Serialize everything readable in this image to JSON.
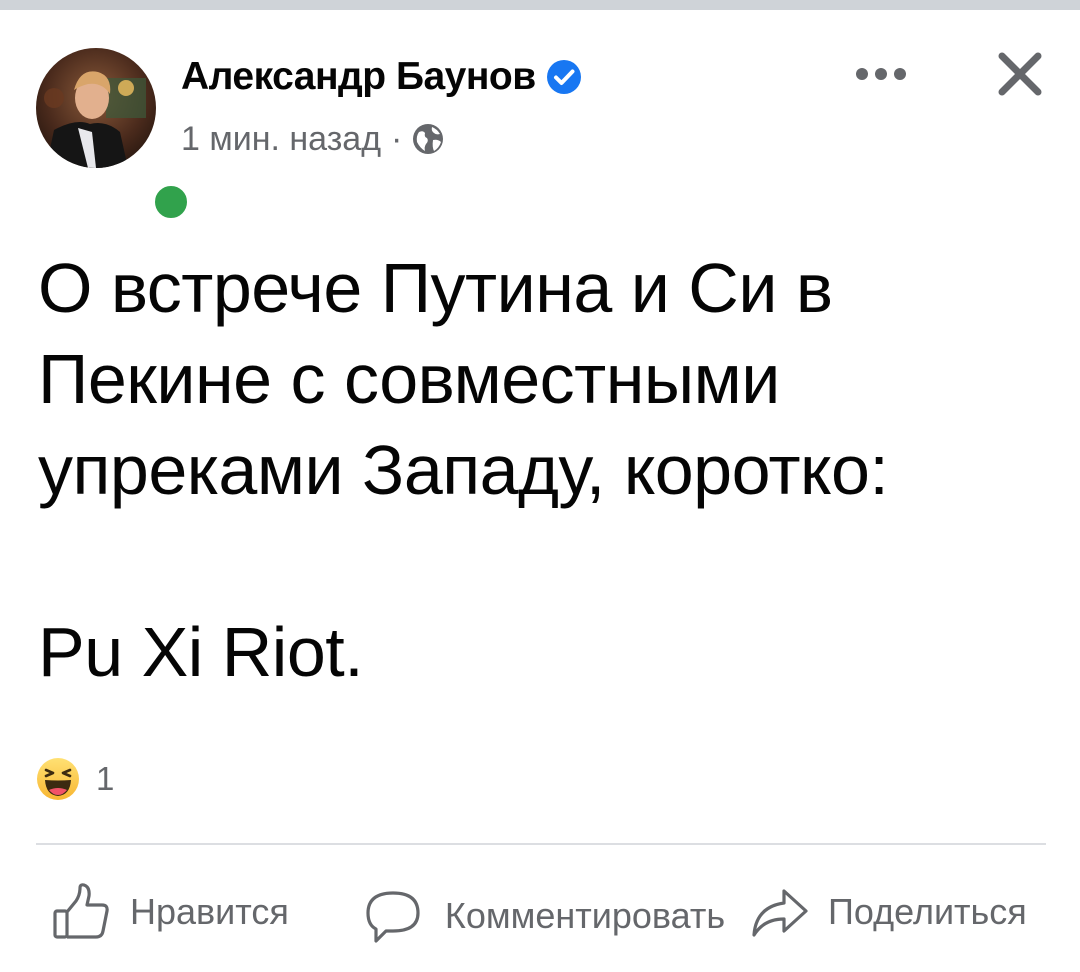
{
  "post": {
    "author": "Александр Баунов",
    "time": "1 мин. назад",
    "separator": "·",
    "paragraphs": [
      "О встрече Путина и Си в",
      "Пекине с совместными",
      "упреками Западу, коротко:",
      "Pu Xi Riot."
    ]
  },
  "reactions": {
    "type": "haha",
    "count": "1"
  },
  "actions": {
    "like_label": "Нравится",
    "comment_label": "Комментировать",
    "share_label": "Поделиться"
  },
  "icons": {
    "verified": "verified-badge-icon",
    "audience": "globe-icon",
    "more": "more-options-icon",
    "close": "close-icon",
    "like": "thumbs-up-icon",
    "comment": "comment-bubble-icon",
    "share": "share-arrow-icon"
  },
  "colors": {
    "verified_blue": "#1877f2",
    "online_green": "#31a24c",
    "secondary_text": "#65676b",
    "primary_text": "#050505"
  }
}
